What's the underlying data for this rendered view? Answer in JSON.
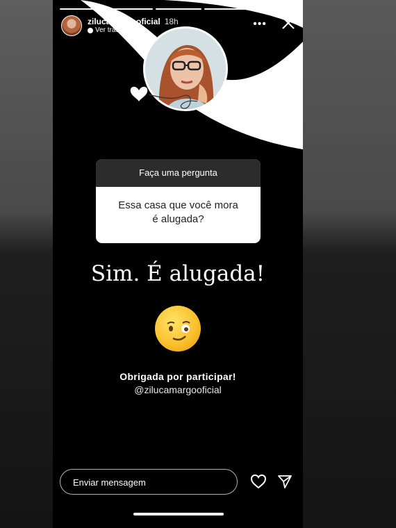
{
  "header": {
    "username": "zilucamargooficial",
    "time": "18h",
    "translate_label": "Ver tradução"
  },
  "sticker": {
    "title": "Faça uma pergunta",
    "question": "Essa casa que  você mora\né alugada?"
  },
  "answer": "Sim. É alugada!",
  "thanks": "Obrigada por participar!",
  "handle": "@zilucamargooficial",
  "reply": {
    "placeholder": "Enviar mensagem"
  },
  "icons": {
    "more": "more-icon",
    "close": "close-icon",
    "like": "heart-icon",
    "send": "send-icon",
    "emoji": "wink-face-emoji"
  },
  "colors": {
    "story_bg": "#000000",
    "sticker_header": "#2c2c2c",
    "text": "#ffffff"
  }
}
